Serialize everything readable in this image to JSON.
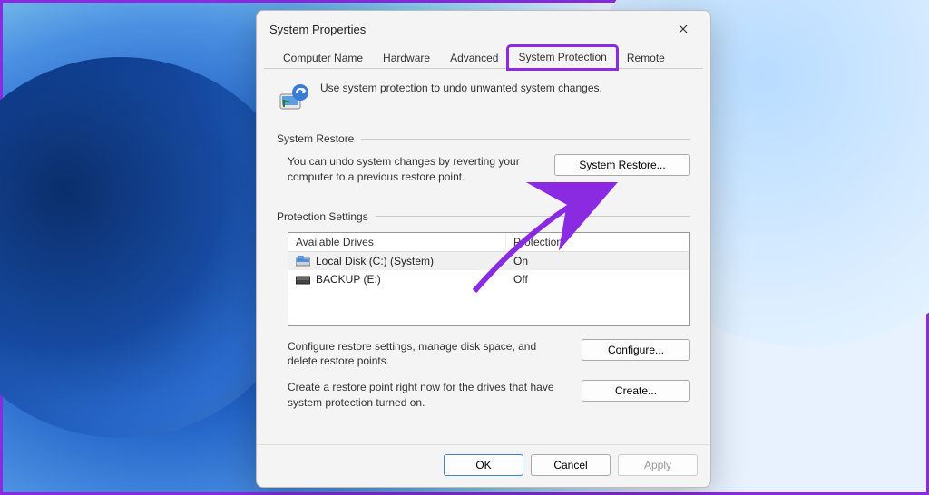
{
  "window": {
    "title": "System Properties"
  },
  "tabs": [
    {
      "label": "Computer Name"
    },
    {
      "label": "Hardware"
    },
    {
      "label": "Advanced"
    },
    {
      "label": "System Protection",
      "active": true,
      "highlight": true
    },
    {
      "label": "Remote"
    }
  ],
  "intro": "Use system protection to undo unwanted system changes.",
  "restore": {
    "group_label": "System Restore",
    "text": "You can undo system changes by reverting your computer to a previous restore point.",
    "button": "System Restore..."
  },
  "protection": {
    "group_label": "Protection Settings",
    "headers": {
      "drive": "Available Drives",
      "protection": "Protection"
    },
    "drives": [
      {
        "name": "Local Disk (C:) (System)",
        "protection": "On",
        "icon": "system-disk",
        "selected": true
      },
      {
        "name": "BACKUP (E:)",
        "protection": "Off",
        "icon": "disk",
        "selected": false
      }
    ],
    "configure_text": "Configure restore settings, manage disk space, and delete restore points.",
    "configure_button": "Configure...",
    "create_text": "Create a restore point right now for the drives that have system protection turned on.",
    "create_button": "Create..."
  },
  "footer": {
    "ok": "OK",
    "cancel": "Cancel",
    "apply": "Apply"
  }
}
